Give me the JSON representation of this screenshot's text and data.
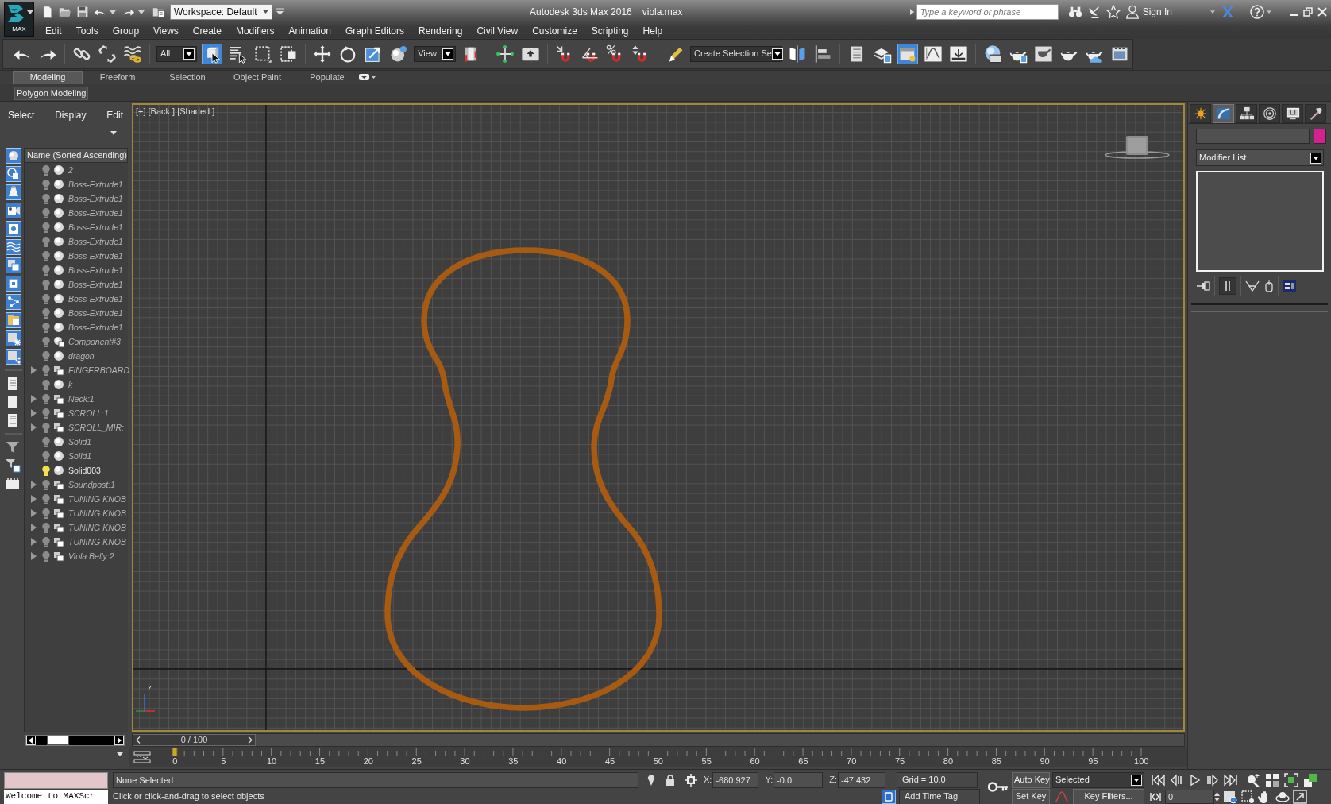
{
  "title_bar": {
    "logo_label": "MAX",
    "workspace": "Workspace: Default",
    "app_title": "Autodesk 3ds Max 2016",
    "file_name": "viola.max",
    "search": {
      "placeholder": "Type a keyword or phrase"
    },
    "sign_in": "Sign In"
  },
  "menu_bar": [
    "Edit",
    "Tools",
    "Group",
    "Views",
    "Create",
    "Modifiers",
    "Animation",
    "Graph Editors",
    "Rendering",
    "Civil View",
    "Customize",
    "Scripting",
    "Help"
  ],
  "main_toolbar": {
    "selection_filter": "All",
    "select_object_on": true,
    "reference_coordinate_system": "View",
    "named_selection_set": "Create Selection Se",
    "ribbon_toggle_on": true
  },
  "ribbon": {
    "tabs": [
      {
        "label": "Modeling",
        "selected": true
      },
      {
        "label": "Freeform",
        "selected": false
      },
      {
        "label": "Selection",
        "selected": false
      },
      {
        "label": "Object Paint",
        "selected": false
      },
      {
        "label": "Populate",
        "selected": false
      }
    ],
    "panel": "Polygon Modeling"
  },
  "scene_explorer": {
    "menus": [
      "Select",
      "Display",
      "Edit"
    ],
    "filters": [
      {
        "kind": "geometry",
        "on": true
      },
      {
        "kind": "shapes",
        "on": true
      },
      {
        "kind": "lights",
        "on": true
      },
      {
        "kind": "cameras",
        "on": true
      },
      {
        "kind": "helpers",
        "on": true
      },
      {
        "kind": "spacewarps",
        "on": true
      },
      {
        "kind": "groups",
        "on": true
      },
      {
        "kind": "xrefs",
        "on": true
      },
      {
        "kind": "bones",
        "on": true
      },
      {
        "kind": "containers",
        "on": true
      },
      {
        "kind": "frozen",
        "on": true
      },
      {
        "kind": "hidden",
        "on": true
      }
    ],
    "column_header": "Name (Sorted Ascending)",
    "items": [
      {
        "name": "2",
        "kind": "object",
        "visible": false,
        "has_children": false
      },
      {
        "name": "Boss-Extrude1",
        "kind": "object",
        "visible": false,
        "has_children": false
      },
      {
        "name": "Boss-Extrude1",
        "kind": "object",
        "visible": false,
        "has_children": false
      },
      {
        "name": "Boss-Extrude1",
        "kind": "object",
        "visible": false,
        "has_children": false
      },
      {
        "name": "Boss-Extrude1",
        "kind": "object",
        "visible": false,
        "has_children": false
      },
      {
        "name": "Boss-Extrude1",
        "kind": "object",
        "visible": false,
        "has_children": false
      },
      {
        "name": "Boss-Extrude1",
        "kind": "object",
        "visible": false,
        "has_children": false
      },
      {
        "name": "Boss-Extrude1",
        "kind": "object",
        "visible": false,
        "has_children": false
      },
      {
        "name": "Boss-Extrude1",
        "kind": "object",
        "visible": false,
        "has_children": false
      },
      {
        "name": "Boss-Extrude1",
        "kind": "object",
        "visible": false,
        "has_children": false
      },
      {
        "name": "Boss-Extrude1",
        "kind": "object",
        "visible": false,
        "has_children": false
      },
      {
        "name": "Boss-Extrude1",
        "kind": "object",
        "visible": false,
        "has_children": false
      },
      {
        "name": "Component#3",
        "kind": "component",
        "visible": false,
        "has_children": false
      },
      {
        "name": "dragon",
        "kind": "object",
        "visible": false,
        "has_children": false
      },
      {
        "name": "FINGERBOARD",
        "kind": "group",
        "visible": false,
        "has_children": true
      },
      {
        "name": "k",
        "kind": "object",
        "visible": false,
        "has_children": false
      },
      {
        "name": "Neck:1",
        "kind": "group",
        "visible": false,
        "has_children": true
      },
      {
        "name": "SCROLL:1",
        "kind": "group",
        "visible": false,
        "has_children": true
      },
      {
        "name": "SCROLL_MIR:",
        "kind": "group",
        "visible": false,
        "has_children": true
      },
      {
        "name": "Solid1",
        "kind": "object",
        "visible": false,
        "has_children": false
      },
      {
        "name": "Solid1",
        "kind": "object",
        "visible": false,
        "has_children": false
      },
      {
        "name": "Solid003",
        "kind": "object",
        "visible": true,
        "has_children": false
      },
      {
        "name": "Soundpost:1",
        "kind": "group",
        "visible": false,
        "has_children": true
      },
      {
        "name": "TUNING KNOB",
        "kind": "group",
        "visible": false,
        "has_children": true
      },
      {
        "name": "TUNING KNOB",
        "kind": "group",
        "visible": false,
        "has_children": true
      },
      {
        "name": "TUNING KNOB",
        "kind": "group",
        "visible": false,
        "has_children": true
      },
      {
        "name": "TUNING KNOB",
        "kind": "group",
        "visible": false,
        "has_children": true
      },
      {
        "name": "Viola Belly:2",
        "kind": "group",
        "visible": false,
        "has_children": true
      }
    ]
  },
  "viewport": {
    "active": true,
    "labels": [
      "[+]",
      "[Back ]",
      "[Shaded ]"
    ],
    "axis_label": "z"
  },
  "command_panel": {
    "tabs": [
      {
        "kind": "create",
        "selected": false
      },
      {
        "kind": "modify",
        "selected": true
      },
      {
        "kind": "hierarchy",
        "selected": false
      },
      {
        "kind": "motion",
        "selected": false
      },
      {
        "kind": "display",
        "selected": false
      },
      {
        "kind": "utilities",
        "selected": false
      }
    ],
    "modifier_list": "Modifier List",
    "show_end_result_on": true
  },
  "time_slider": {
    "label": "0 / 100",
    "level": 0
  },
  "track_bar": {
    "labels": [
      "0",
      "5",
      "10",
      "15",
      "20",
      "25",
      "30",
      "35",
      "40",
      "45",
      "50",
      "55",
      "60",
      "65",
      "70",
      "75",
      "80",
      "85",
      "90",
      "95",
      "100"
    ]
  },
  "status_bar": {
    "listener_output": "Welcome to MAXScr",
    "selection": "None Selected",
    "prompt": "Click or click-and-drag to select objects",
    "coordinates": [
      {
        "axis": "X:",
        "value": "-680.927"
      },
      {
        "axis": "Y:",
        "value": "-0.0"
      },
      {
        "axis": "Z:",
        "value": "-47.432"
      }
    ],
    "grid": "Grid = 10.0",
    "add_time_tag": "Add Time Tag",
    "auto_key": "Auto Key",
    "set_key": "Set Key",
    "key_filter_set": "Selected",
    "key_filters": "Key Filters...",
    "current_frame": "0"
  }
}
